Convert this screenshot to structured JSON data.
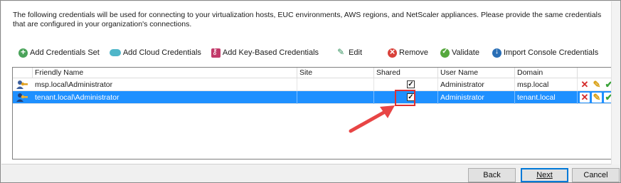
{
  "intro_text": "The following credentials will be used for connecting to your virtualization hosts, EUC environments, AWS regions, and NetScaler appliances. Please provide the same credentials that are configured in your organization's connections.",
  "toolbar": {
    "add_credentials_set": "Add Credentials Set",
    "add_cloud_credentials": "Add Cloud Credentials",
    "add_key_based_credentials": "Add Key-Based Credentials",
    "edit": "Edit",
    "remove": "Remove",
    "validate": "Validate",
    "import_console_credentials": "Import Console Credentials"
  },
  "grid": {
    "columns": [
      "Friendly Name",
      "Site",
      "Shared",
      "User Name",
      "Domain"
    ],
    "rows": [
      {
        "friendly_name": "msp.local\\Administrator",
        "site": "",
        "shared": true,
        "user_name": "Administrator",
        "domain": "msp.local",
        "selected": false
      },
      {
        "friendly_name": "tenant.local\\Administrator",
        "site": "",
        "shared": true,
        "user_name": "Administrator",
        "domain": "tenant.local",
        "selected": true
      }
    ]
  },
  "buttons": {
    "back": "Back",
    "next": "Next",
    "cancel": "Cancel"
  },
  "colors": {
    "selection": "#1e90ff",
    "highlight": "#e03030",
    "accent": "#0078d7"
  }
}
